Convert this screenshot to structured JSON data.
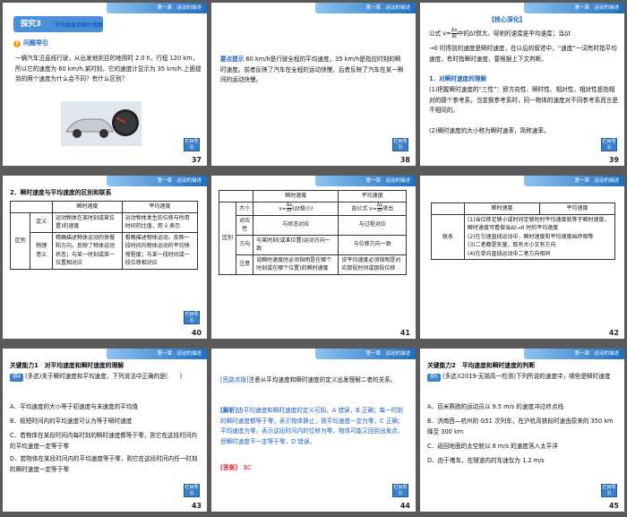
{
  "header_text": "第一章　运动的描述",
  "nav_label": "栏目导引",
  "slides": {
    "s37": {
      "page": "37",
      "title": "探究3",
      "subtitle": "平均速度和瞬时速度",
      "question_heading": "问题导引",
      "body": "一辆汽车沿直线行驶，从出发地到目的地用时 2.0 h，行程 120 km，所以它的速度为 60 km/h.某时刻，它的速度计显示为 35 km/h.上面提到的两个速度为什么会不同？有什么区别？"
    },
    "s38": {
      "page": "38",
      "label": "要点提示",
      "body": "60 km/h是行驶全程的平均速度，35 km/h是指应时刻的瞬时速度。前者反映了汽车在全程的运动快慢，后者反映了汽车在某一瞬间的运动快慢。"
    },
    "s39": {
      "page": "39",
      "heading": "【核心深化】",
      "formula_pre": "公式 v=",
      "formula_post": "中的Δt很大，得到的速度是平均速度；当Δt",
      "para1": "→0 时得到的速度是瞬时速度，在以后的叙述中，“速度”一词有时指平均速度，有时指瞬时速度，要根据上下文判断。",
      "sec1": "1．对瞬时速度的理解",
      "p1": "(1)把握瞬时速度的“三性”：即方向性、瞬时性、相对性，相对性是指相对的那个参考系，当变换参考系时，同一物体的速度对不同参考系而言是不相同的。",
      "p2": "(2)瞬时速度的大小称为瞬时速率，简称速率。"
    },
    "s40": {
      "page": "40",
      "heading": "2．瞬时速度与平均速度的区别和联系",
      "col_inst": "瞬时速度",
      "col_avg": "平均速度",
      "region": "区别",
      "r1_label": "定义",
      "r1_inst": "运动物体在某时刻或某位置)的速度",
      "r1_avg": "运动物体发生的位移与所用时间的比值，用 v̄ 表示",
      "r2_label": "物理意义",
      "r2_inst": "精确描述物体运动的快慢和方向，反映了物体运动状态；与某一时刻或某一位置相对应",
      "r2_avg": "粗略描述物体运动，反映一段时间内物体运动的平均快慢程度；与某一段时间或一段位移相对应"
    },
    "s41": {
      "page": "41",
      "col_inst": "瞬时速度",
      "col_avg": "平均速度",
      "region": "区别",
      "size": "大小",
      "size_inst_pre": "v=",
      "size_inst_post": "(Δt极小)",
      "size_avg_pre": "由公式 v=",
      "size_avg_post": "求出",
      "corr": "对应性",
      "corr_inst": "与状态对应",
      "corr_avg": "与过程对应",
      "dir": "方向",
      "dir_inst": "与某时刻(或某位置)运动方向一致",
      "dir_avg": "与位移方向一致",
      "note": "注意",
      "note_inst": "说瞬时速度时必须指明是在哪个时刻或在哪个位置)的瞬时速度",
      "note_avg": "说平均速度必须指明是对应那段时间或那段位移"
    },
    "s42": {
      "page": "42",
      "col_inst": "瞬时速度",
      "col_avg": "平均速度",
      "rel": "联系",
      "l1": "(1)当位移足够小或时间足够短时平均速度就等于瞬时速度，瞬时速度可看做当Δt→0 时的平均速度",
      "l2": "(2)在匀速直线运动中，瞬时速度和平均速度始终相等",
      "l3": "(3)二者都是矢量，既有大小又有方向",
      "l4": "(4)在单向直线运动中二者方向相同"
    },
    "s43": {
      "page": "43",
      "heading": "关键能力1　对平均速度和瞬时速度的理解",
      "example": "例4",
      "stem": "(多选)关于瞬时速度和平均速度，下列说法中正确的是(　　)",
      "a": "A．平均速度的大小等于初速度与末速度的平均值",
      "b": "B．极短时间内的平均速度可认为等于瞬时速度",
      "c": "C．若物体在某段时间内每时刻的瞬时速度都等于零，则它在这段时间内的平均速度一定等于零",
      "d": "D．若物体在某段时间内的平均速度等于零，则它在这段时间内任一时刻的瞬时速度一定等于零"
    },
    "s44": {
      "page": "44",
      "hint_label": "[思路点拨]",
      "hint": "注意从平均速度和瞬时速度的定义出发理解二者的关系。",
      "analysis_label": "[解析]",
      "analysis": "由平均速度和瞬时速度的定义可知，A 错误，B 正确；每一时刻的瞬时速度都等于零，表示物体静止，则平均速度一定为零，C 正确；平均速度为零，表示这段时间内的位移为零，物体可能又回到出发点，但瞬时速度不一定等于零，D 错误。",
      "answer_label": "[答案]",
      "answer": "BC"
    },
    "s45": {
      "page": "45",
      "heading": "关键能力2　平均速度和瞬时速度的判断",
      "example": "例5",
      "stem": "(多选)(2019·无锡高一检测)下列所说的速度中，哪些是瞬时速度",
      "a": "A．百米赛跑的运动员以 9.5 m/s 的速度冲过终点线",
      "b": "B．济南西—杭州的 G51 次列车，在沪杭高铁段时速由原来的 350 km 降至 300 km",
      "c": "C．返回地面的太空舱以 8 m/s 的速度落入太平洋",
      "d": "D．由于堵车，在隧道内的车速仅为 1.2 m/s"
    }
  }
}
